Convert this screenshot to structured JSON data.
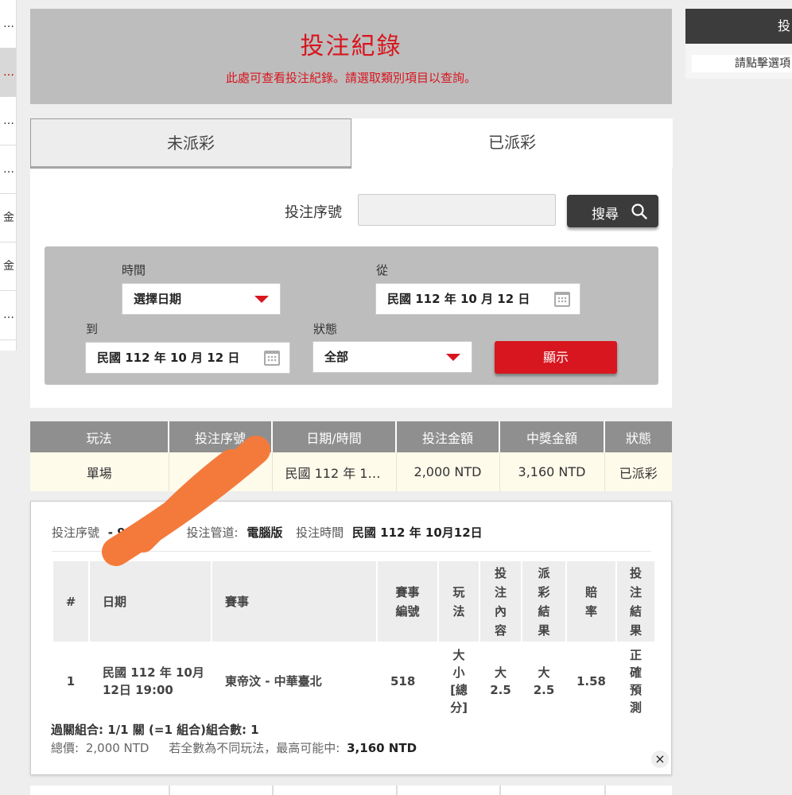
{
  "left_sidebar": {
    "items": [
      {
        "label": "…",
        "active": false
      },
      {
        "label": "…",
        "active": true
      },
      {
        "label": "…",
        "active": false
      },
      {
        "label": "…",
        "active": false
      },
      {
        "label": "金",
        "active": false
      },
      {
        "label": "金",
        "active": false
      },
      {
        "label": "…",
        "active": false
      }
    ]
  },
  "right_panel": {
    "header": "投",
    "hint": "請點擊選項"
  },
  "header": {
    "title": "投注紀錄",
    "subtitle": "此處可查看投注紀錄。請選取類別項目以查詢。"
  },
  "tabs": {
    "unpaid": "未派彩",
    "paid": "已派彩"
  },
  "search": {
    "label": "投注序號",
    "value": "",
    "button_label": "搜尋"
  },
  "filters": {
    "time_label": "時間",
    "time_value": "選擇日期",
    "from_label": "從",
    "from_value": "民國 112 年 10 月 12 日",
    "to_label": "到",
    "to_value": "民國 112 年 10 月 12 日",
    "status_label": "狀態",
    "status_value": "全部",
    "show_button": "顯示"
  },
  "results": {
    "headers": [
      "玩法",
      "投注序號",
      "日期/時間",
      "投注金額",
      "中獎金額",
      "狀態"
    ],
    "row": [
      "單場",
      "9…",
      "民國 112 年 1…",
      "2,000 NTD",
      "3,160 NTD",
      "已派彩"
    ]
  },
  "detail": {
    "serial_label": "投注序號",
    "serial_value": "- 9",
    "channel_label": "投注管道:",
    "channel_value": "電腦版",
    "time_label": "投注時間",
    "time_value": "民國 112 年 10月12日",
    "headers": [
      "#",
      "日期",
      "賽事",
      "賽事\n編號",
      "玩\n法",
      "投\n注\n內\n容",
      "派\n彩\n結\n果",
      "賠\n率",
      "投\n注\n結\n果"
    ],
    "row": [
      "1",
      "民國 112 年 10月\n12日 19:00",
      "東帝汶 - 中華臺北",
      "518",
      "大\n小\n[總\n分]",
      "大\n2.5",
      "大\n2.5",
      "1.58",
      "正\n確\n預\n測"
    ],
    "summary_combo": "過關組合: 1/1 關 (=1 組合)組合數: 1",
    "total_label": "總價:",
    "total_value": "2,000 NTD",
    "max_label": "若全數為不同玩法，最高可能中:",
    "max_value": "3,160 NTD",
    "close": "×"
  },
  "colors": {
    "accent_red": "#d7161f",
    "dark_button": "#3b3b3b",
    "redaction_orange": "#f47a3c"
  }
}
